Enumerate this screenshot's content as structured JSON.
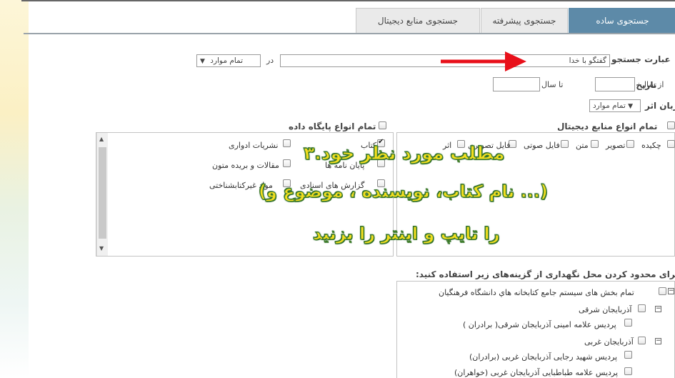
{
  "tabs": {
    "simple": "جستجوی ساده",
    "advanced": "جستجوی پیشرفته",
    "digital": "جستجوی منابع دیجیتال"
  },
  "search": {
    "phrase_label": "عبارت جستجو",
    "query": "گفتگو با خدا",
    "in_label": "در",
    "scope": "تمام موارد",
    "date_label": "تاریخ اثر",
    "from_year": "از سال",
    "to_year": "تا سال",
    "language_label": "زبان اثر",
    "language": "تمام موارد"
  },
  "digital_sources": {
    "all_label": "تمام انواع منابع دیجیتال",
    "items": [
      "چکیده",
      "تصویر",
      "متن",
      "فایل صوتی",
      "فایل تصویری",
      "اثر"
    ]
  },
  "databases": {
    "all_label": "تمام انواع پایگاه داده",
    "items": [
      "نشریات ادواری",
      "مقالات و بریده متون",
      "مواد غیرکتابشناختی",
      "کتاب",
      "پایان نامه ها",
      "گزارش های اسنادی"
    ]
  },
  "holdings": {
    "heading": "برای محدود کردن محل نگهداری از گزینه‌های زیر استفاده کنید:",
    "tree": [
      "تمام بخش های سیستم جامع کتابخانه هاي دانشگاه فرهنگیان",
      "آذربایجان شرقی",
      "پردیس علامه امینی آذربایجان شرقی( برادران )",
      "آذربایجان غربی",
      "پردیس شهید رجایی آذربایجان غربی (برادران)",
      "پردیس علامه طباطبایی آذربایجان غربی (خواهران)"
    ]
  },
  "overlay": {
    "line1": "۳.مطلب مورد نظر خود",
    "line2": "(نام کتاب، نویسنده ، موضوع و ...)",
    "line3": "را تایپ و اینتر را بزنید",
    "arrow_color": "#e8101a",
    "text_color": "#f3de1e",
    "outline_color": "#3a7a2f"
  },
  "colors": {
    "active_tab": "#5d8aa8",
    "inactive_tab": "#eaeaea"
  }
}
